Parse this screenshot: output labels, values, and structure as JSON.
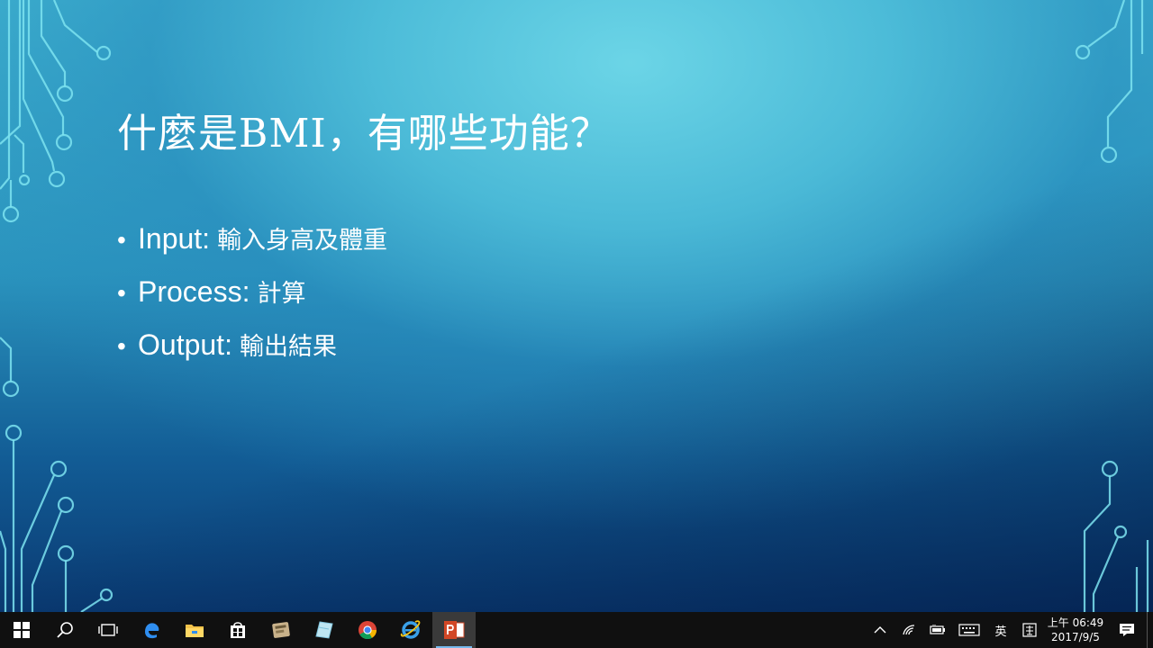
{
  "slide": {
    "title": "什麼是BMI，有哪些功能？",
    "bullets": [
      {
        "label": "Input:",
        "text": "輸入身高及體重"
      },
      {
        "label": "Process:",
        "text": "計算"
      },
      {
        "label": "Output:",
        "text": "輸出結果"
      }
    ],
    "bullet_symbol": "•"
  },
  "taskbar": {
    "icons": [
      {
        "name": "start-button-icon"
      },
      {
        "name": "search-icon"
      },
      {
        "name": "task-view-icon"
      },
      {
        "name": "edge-icon"
      },
      {
        "name": "file-explorer-icon"
      },
      {
        "name": "store-icon"
      },
      {
        "name": "app-icon"
      },
      {
        "name": "notebook-app-icon"
      },
      {
        "name": "chrome-icon"
      },
      {
        "name": "internet-explorer-icon"
      },
      {
        "name": "powerpoint-icon",
        "running": true
      }
    ],
    "tray": {
      "ime_label": "英",
      "time": "上午 06:49",
      "date": "2017/9/5"
    }
  },
  "colors": {
    "taskbar_bg": "#101010",
    "accent": "#76b9ed",
    "powerpoint": "#d24726",
    "circuit": "#7de3f0"
  }
}
